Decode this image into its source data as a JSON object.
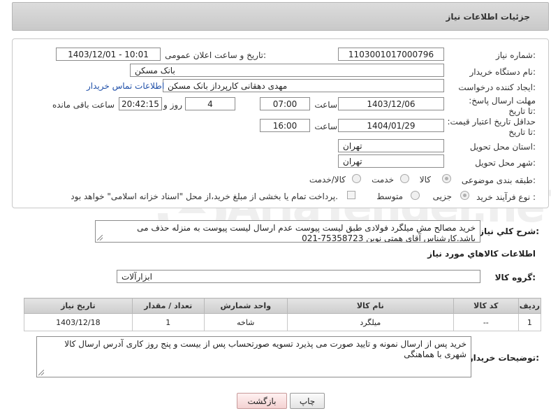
{
  "header": {
    "title": "جزئیات اطلاعات نیاز"
  },
  "labels": {
    "need_number": "شماره نیاز:",
    "announce_datetime": "تاریخ و ساعت اعلان عمومی:",
    "buyer_org": "نام دستگاه خریدار:",
    "requester": "ایجاد کننده درخواست:",
    "reply_deadline": "مهلت ارسال پاسخ: تا تاریخ:",
    "price_validity": "حداقل تاریخ اعتبار قیمت: تا تاریخ:",
    "delivery_province": "استان محل تحویل:",
    "delivery_city": "شهر محل تحویل:",
    "category": "طبقه بندی موضوعی:",
    "purchase_type": "نوع فرآیند خرید :",
    "hour": "ساعت",
    "day_and": "روز و",
    "hours_remaining": "ساعت باقی مانده",
    "general_description": "شرح کلي نياز:",
    "items_info": "اطلاعات کالاهاي مورد نياز",
    "goods_group": "گروه کالا:",
    "buyer_notes": "توضیحات خریدار:"
  },
  "values": {
    "need_number": "1103001017000796",
    "announce_datetime": "1403/12/01 - 10:01",
    "buyer_org": "بانک مسکن",
    "requester": "مهدی دهقانی کارپرداز بانک مسکن",
    "contact_link": "اطلاعات تماس خریدار",
    "reply_date": "1403/12/06",
    "reply_time": "07:00",
    "reply_days": "4",
    "remaining_time": "20:42:15",
    "validity_date": "1404/01/29",
    "validity_time": "16:00",
    "delivery_province": "تهران",
    "delivery_city": "تهران",
    "goods_group": "ابزارآلات"
  },
  "category_options": [
    {
      "label": "کالا",
      "selected": true
    },
    {
      "label": "خدمت",
      "selected": false
    },
    {
      "label": "کالا/خدمت",
      "selected": false
    }
  ],
  "purchase_options": [
    {
      "label": "جزیی",
      "selected": true
    },
    {
      "label": "متوسط",
      "selected": false
    }
  ],
  "payment_note": "پرداخت تمام یا بخشی از مبلغ خرید،از محل \"اسناد خزانه اسلامی\" خواهد بود.",
  "description": "خرید مصالح مش میلگرد فولادی طبق لیست پیوست عدم ارسال لیست پیوست به منزله حذف می باشد.کارشناس آقای همتی نوین 75358723-021",
  "table": {
    "headers": [
      "ردیف",
      "کد کالا",
      "نام کالا",
      "واحد شمارش",
      "تعداد / مقدار",
      "تاریخ نیاز"
    ],
    "rows": [
      [
        "1",
        "--",
        "میلگرد",
        "شاخه",
        "1",
        "1403/12/18"
      ]
    ]
  },
  "buyer_notes": "خرید پس از ارسال نمونه و تایید صورت می پذیرد تسویه صورتحساب پس از بیست و پنج روز کاری آدرس ارسال کالا شهری با هماهنگی",
  "buttons": {
    "print": "چاپ",
    "back": "بازگشت"
  },
  "watermark": {
    "text": "AriaTender.neT"
  }
}
